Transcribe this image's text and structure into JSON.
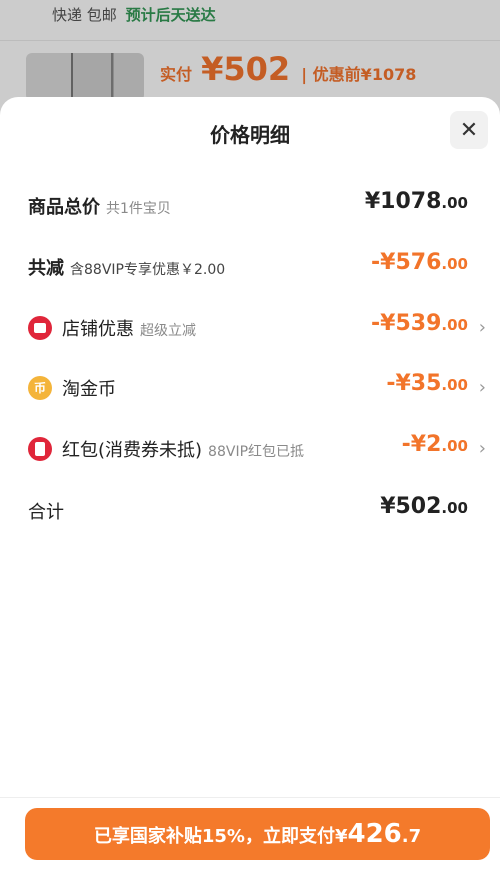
{
  "background": {
    "shipping": "快递 包邮",
    "eta": "预计后天送达",
    "paid_label": "实付",
    "paid_amount": "¥502",
    "original_label": "| 优惠前¥1078"
  },
  "sheet": {
    "title": "价格明细",
    "close_icon": "close-icon"
  },
  "rows": {
    "total": {
      "label": "商品总价",
      "sub": "共1件宝贝",
      "int": "¥1078",
      "dec": ".00"
    },
    "reduce": {
      "label": "共减",
      "sub": "含88VIP专享优惠￥2.00",
      "int": "-¥576",
      "dec": ".00"
    },
    "shop": {
      "label": "店铺优惠",
      "sub": "超级立减",
      "int": "-¥539",
      "dec": ".00"
    },
    "coin": {
      "label": "淘金币",
      "int": "-¥35",
      "dec": ".00"
    },
    "redpack": {
      "label": "红包(消费券未抵)",
      "sub": "88VIP红包已抵",
      "int": "-¥2",
      "dec": ".00"
    },
    "sum": {
      "label": "合计",
      "int": "¥502",
      "dec": ".00"
    }
  },
  "pay_button": {
    "text": "已享国家补贴15%，立即支付",
    "currency": "¥",
    "amount": "426",
    "dec": ".7"
  },
  "colors": {
    "accent": "#f47a2b",
    "discount": "#f2742a",
    "eta": "#2f8b4f"
  }
}
